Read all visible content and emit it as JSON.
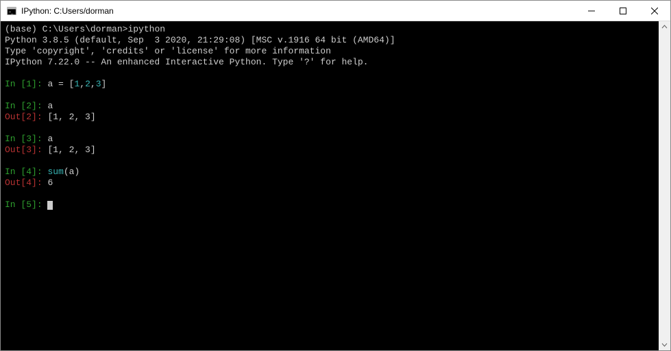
{
  "window": {
    "title": "IPython: C:Users/dorman"
  },
  "banner": {
    "l1a": "(base) C:\\Users\\dorman>",
    "l1b": "ipython",
    "l2": "Python 3.8.5 (default, Sep  3 2020, 21:29:08) [MSC v.1916 64 bit (AMD64)]",
    "l3": "Type 'copyright', 'credits' or 'license' for more information",
    "l4": "IPython 7.22.0 -- An enhanced Interactive Python. Type '?' for help."
  },
  "cells": {
    "c1": {
      "in_open": "In [",
      "in_num": "1",
      "in_close": "]: ",
      "code_a": "a = [",
      "code_b": "1",
      "code_c": ",",
      "code_d": "2",
      "code_e": ",",
      "code_f": "3",
      "code_g": "]"
    },
    "c2": {
      "in_open": "In [",
      "in_num": "2",
      "in_close": "]: ",
      "code": "a",
      "out_open": "Out[",
      "out_num": "2",
      "out_close": "]: ",
      "out_val": "[1, 2, 3]"
    },
    "c3": {
      "in_open": "In [",
      "in_num": "3",
      "in_close": "]: ",
      "code": "a",
      "out_open": "Out[",
      "out_num": "3",
      "out_close": "]: ",
      "out_val": "[1, 2, 3]"
    },
    "c4": {
      "in_open": "In [",
      "in_num": "4",
      "in_close": "]: ",
      "code_a": "sum",
      "code_b": "(a)",
      "out_open": "Out[",
      "out_num": "4",
      "out_close": "]: ",
      "out_val": "6"
    },
    "c5": {
      "in_open": "In [",
      "in_num": "5",
      "in_close": "]: "
    }
  }
}
